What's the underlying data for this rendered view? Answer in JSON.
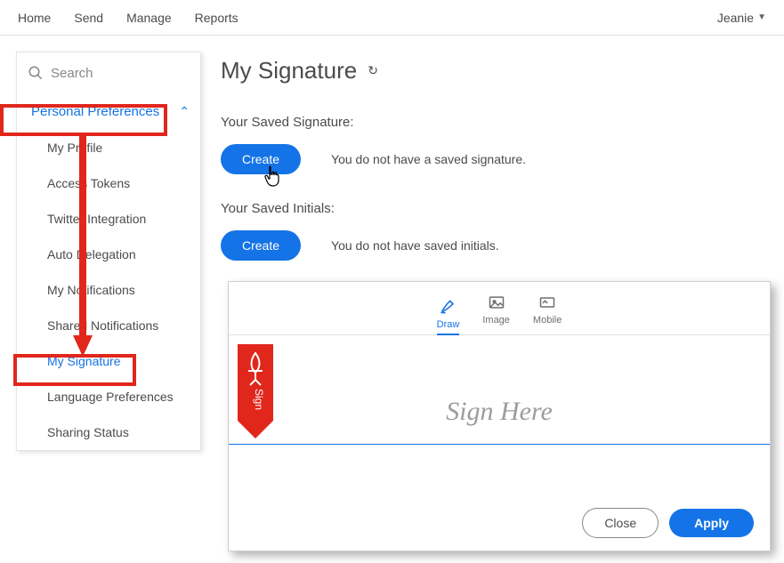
{
  "topnav": {
    "links": [
      "Home",
      "Send",
      "Manage",
      "Reports"
    ],
    "user": "Jeanie"
  },
  "sidebar": {
    "search_placeholder": "Search",
    "section_title": "Personal Preferences",
    "items": [
      {
        "label": "My Profile"
      },
      {
        "label": "Access Tokens"
      },
      {
        "label": "Twitter Integration"
      },
      {
        "label": "Auto Delegation"
      },
      {
        "label": "My Notifications"
      },
      {
        "label": "Shared Notifications"
      },
      {
        "label": "My Signature",
        "selected": true
      },
      {
        "label": "Language Preferences"
      },
      {
        "label": "Sharing Status"
      }
    ]
  },
  "content": {
    "title": "My Signature",
    "saved_signature_label": "Your Saved Signature:",
    "create_btn": "Create",
    "no_signature": "You do not have a saved signature.",
    "saved_initials_label": "Your Saved Initials:",
    "no_initials": "You do not have saved initials."
  },
  "modal": {
    "tabs": [
      {
        "label": "Draw",
        "active": true
      },
      {
        "label": "Image"
      },
      {
        "label": "Mobile"
      }
    ],
    "placeholder": "Sign Here",
    "ribbon_text": "Sign",
    "close_btn": "Close",
    "apply_btn": "Apply"
  }
}
